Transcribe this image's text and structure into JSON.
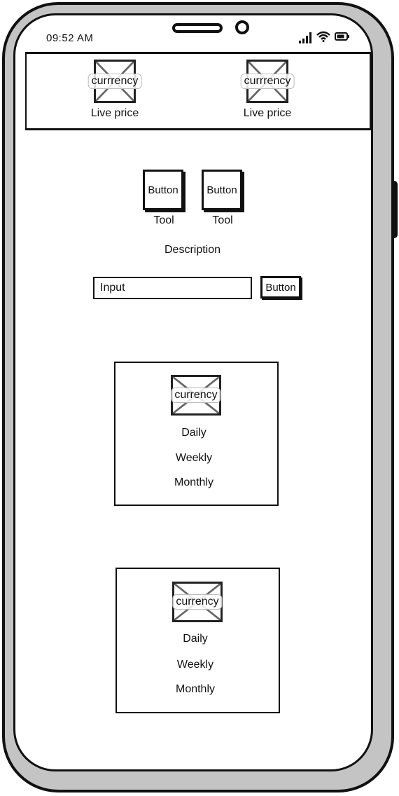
{
  "status_bar": {
    "time": "09:52 AM"
  },
  "header": {
    "tickers": [
      {
        "image_label": "currrency",
        "caption": "Live price"
      },
      {
        "image_label": "currrency",
        "caption": "Live price"
      }
    ]
  },
  "tools": {
    "buttons": [
      {
        "label": "Button",
        "caption": "Tool"
      },
      {
        "label": "Button",
        "caption": "Tool"
      }
    ],
    "description": "Description"
  },
  "form": {
    "input_value": "Input",
    "button_label": "Button"
  },
  "cards": [
    {
      "image_label": "currency",
      "periods": [
        "Daily",
        "Weekly",
        "Monthly"
      ]
    },
    {
      "image_label": "currency",
      "periods": [
        "Daily",
        "Weekly",
        "Monthly"
      ]
    }
  ],
  "icons": [
    "signal-icon",
    "wifi-icon",
    "battery-icon"
  ]
}
